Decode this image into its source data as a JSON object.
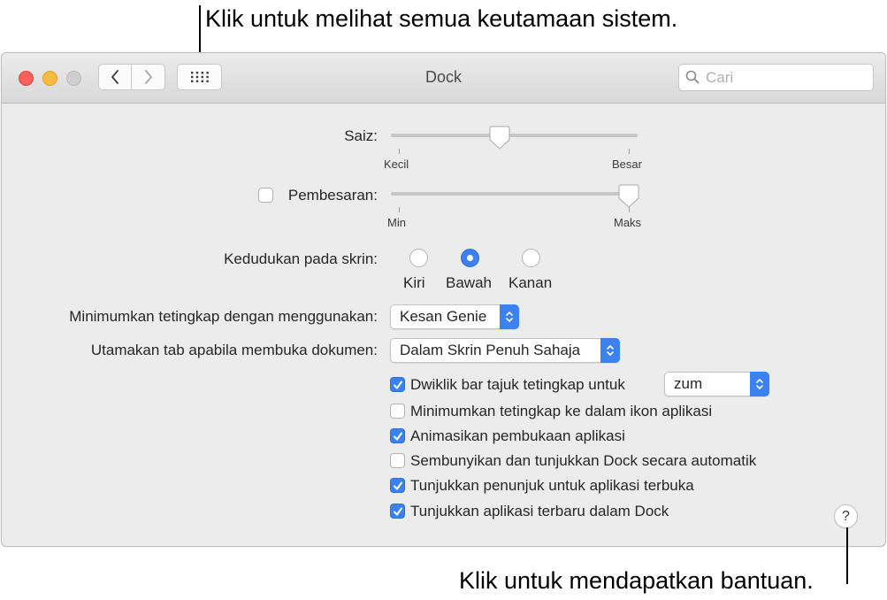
{
  "callouts": {
    "top": "Klik untuk melihat semua keutamaan sistem.",
    "bottom": "Klik untuk mendapatkan bantuan."
  },
  "window": {
    "title": "Dock",
    "search_placeholder": "Cari",
    "traffic_colors": {
      "close": "#fc605b",
      "minimize": "#fdbc40",
      "zoom": "#cfcfcf"
    }
  },
  "size": {
    "label": "Saiz:",
    "min_label": "Kecil",
    "max_label": "Besar",
    "value": 0.44
  },
  "magnification": {
    "label": "Pembesaran:",
    "checked": false,
    "min_label": "Min",
    "max_label": "Maks",
    "value": 1.0
  },
  "position": {
    "label": "Kedudukan pada skrin:",
    "options": [
      "Kiri",
      "Bawah",
      "Kanan"
    ],
    "selected": "Bawah"
  },
  "minimize_using": {
    "label": "Minimumkan tetingkap dengan menggunakan:",
    "value": "Kesan Genie"
  },
  "prefer_tabs": {
    "label": "Utamakan tab apabila membuka dokumen:",
    "value": "Dalam Skrin Penuh Sahaja"
  },
  "options": {
    "double_click": {
      "label": "Dwiklik bar tajuk tetingkap untuk",
      "checked": true,
      "value": "zum"
    },
    "minimize_into_icon": {
      "label": "Minimumkan tetingkap ke dalam ikon aplikasi",
      "checked": false
    },
    "animate": {
      "label": "Animasikan pembukaan aplikasi",
      "checked": true
    },
    "autohide": {
      "label": "Sembunyikan dan tunjukkan Dock secara automatik",
      "checked": false
    },
    "indicators": {
      "label": "Tunjukkan penunjuk untuk aplikasi terbuka",
      "checked": true
    },
    "recent_apps": {
      "label": "Tunjukkan aplikasi terbaru dalam Dock",
      "checked": true
    }
  },
  "help": {
    "label": "?"
  },
  "accent_color": "#3b82f0"
}
